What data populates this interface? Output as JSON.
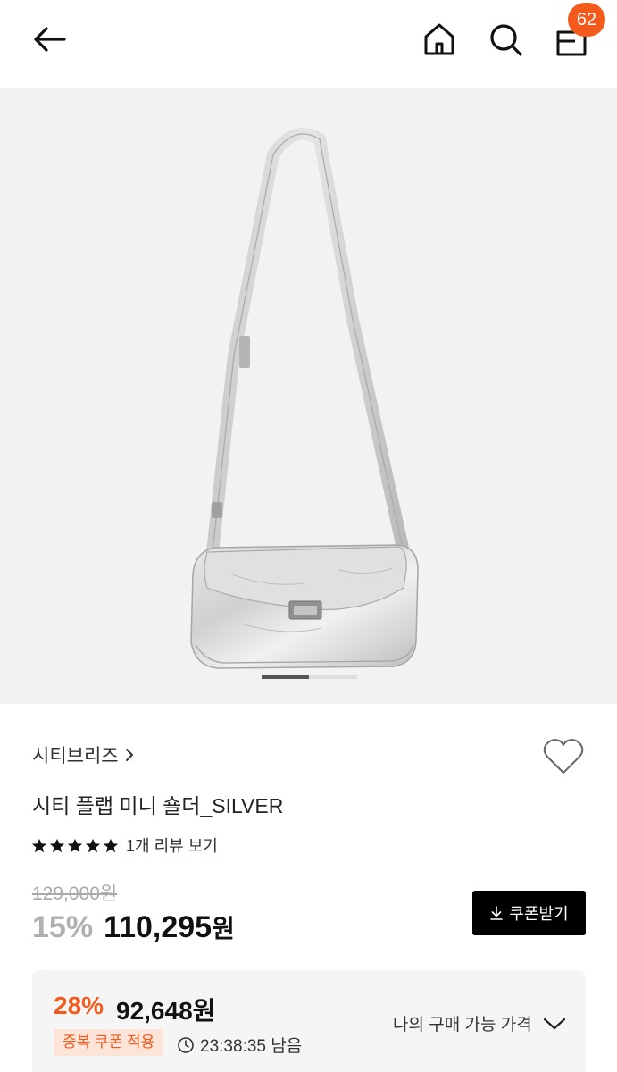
{
  "header": {
    "cart_count": "62",
    "icons": [
      "back-arrow-icon",
      "home-icon",
      "search-icon",
      "shopping-bag-icon"
    ]
  },
  "product": {
    "brand": "시티브리즈",
    "title": "시티 플랩 미니 숄더_SILVER",
    "rating_stars": 5,
    "review_link": "1개 리뷰 보기",
    "original_price": "129,000원",
    "discount_rate": "15%",
    "sale_price": "110,295",
    "currency": "원",
    "image_count": 2,
    "image_index": 1
  },
  "coupon_button": {
    "label": "쿠폰받기",
    "icon": "download-icon"
  },
  "benefit": {
    "rate": "28%",
    "price": "92,648원",
    "tag": "중복 쿠폰 적용",
    "timer": "23:38:35 남음",
    "my_price_label": "나의 구매 가능 가격"
  },
  "colors": {
    "accent": "#f45a1b",
    "tag_bg": "#fde4d8",
    "button_bg": "#000000",
    "hero_bg": "#f2f2f2",
    "benefit_bg": "#f5f5f5"
  }
}
